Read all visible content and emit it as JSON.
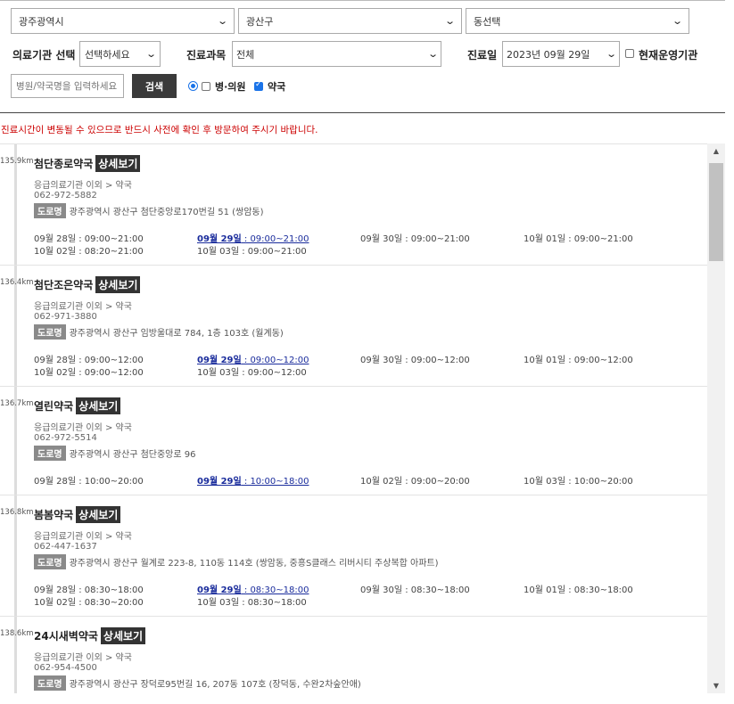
{
  "filters": {
    "region": "광주광역시",
    "district": "광산구",
    "dong": "동선택",
    "institution_label": "의료기관 선택",
    "institution_value": "선택하세요",
    "department_label": "진료과목",
    "department_value": "전체",
    "date_label": "진료일",
    "date_value": "2023년 09월 29일",
    "open_now_label": "현재운영기관",
    "search_placeholder": "병원/약국명을 입력하세요",
    "search_button": "검색",
    "hospital_label": "병·의원",
    "pharmacy_label": "약국"
  },
  "notice": "진료시간이 변동될 수 있으므로 반드시 사전에 확인 후 방문하여 주시기 바랍니다.",
  "colors": {
    "accent": "#1a73e8",
    "notice": "#cc0000",
    "today": "#1a2c9c",
    "detail_bg": "#333333",
    "road_bg": "#8a8a8a"
  },
  "results": [
    {
      "distance": "135.9km",
      "name": "첨단종로약국",
      "detail": "상세보기",
      "category": "응급의료기관 이외 > 약국",
      "phone": "062-972-5882",
      "road": "도로명",
      "address": "광주광역시 광산구 첨단중앙로170번길 51 (쌍암동)",
      "hours": [
        {
          "day": "09월 28일",
          "time": " : 09:00~21:00",
          "today": false
        },
        {
          "day": "09월 29일",
          "time": " : 09:00~21:00",
          "today": true
        },
        {
          "day": "09월 30일",
          "time": " : 09:00~21:00",
          "today": false
        },
        {
          "day": "10월 01일",
          "time": " : 09:00~21:00",
          "today": false
        },
        {
          "day": "10월 02일",
          "time": " : 08:20~21:00",
          "today": false
        },
        {
          "day": "10월 03일",
          "time": " : 09:00~21:00",
          "today": false
        }
      ]
    },
    {
      "distance": "136.4km",
      "name": "첨단조은약국",
      "detail": "상세보기",
      "category": "응급의료기관 이외 > 약국",
      "phone": "062-971-3880",
      "road": "도로명",
      "address": "광주광역시 광산구 임방울대로 784, 1층 103호 (월계동)",
      "hours": [
        {
          "day": "09월 28일",
          "time": " : 09:00~12:00",
          "today": false
        },
        {
          "day": "09월 29일",
          "time": " : 09:00~12:00",
          "today": true
        },
        {
          "day": "09월 30일",
          "time": " : 09:00~12:00",
          "today": false
        },
        {
          "day": "10월 01일",
          "time": " : 09:00~12:00",
          "today": false
        },
        {
          "day": "10월 02일",
          "time": " : 09:00~12:00",
          "today": false
        },
        {
          "day": "10월 03일",
          "time": " : 09:00~12:00",
          "today": false
        }
      ]
    },
    {
      "distance": "136.7km",
      "name": "열린약국",
      "detail": "상세보기",
      "category": "응급의료기관 이외 > 약국",
      "phone": "062-972-5514",
      "road": "도로명",
      "address": "광주광역시 광산구 첨단중앙로 96",
      "hours": [
        {
          "day": "09월 28일",
          "time": " : 10:00~20:00",
          "today": false
        },
        {
          "day": "09월 29일",
          "time": " : 10:00~18:00",
          "today": true
        },
        {
          "day": "10월 02일",
          "time": " : 09:00~20:00",
          "today": false
        },
        {
          "day": "10월 03일",
          "time": " : 10:00~20:00",
          "today": false
        }
      ]
    },
    {
      "distance": "136.8km",
      "name": "봄봄약국",
      "detail": "상세보기",
      "category": "응급의료기관 이외 > 약국",
      "phone": "062-447-1637",
      "road": "도로명",
      "address": "광주광역시 광산구 월계로 223-8, 110동 114호 (쌍암동, 중흥S클래스 리버시티 주상복합 아파트)",
      "hours": [
        {
          "day": "09월 28일",
          "time": " : 08:30~18:00",
          "today": false
        },
        {
          "day": "09월 29일",
          "time": " : 08:30~18:00",
          "today": true
        },
        {
          "day": "09월 30일",
          "time": " : 08:30~18:00",
          "today": false
        },
        {
          "day": "10월 01일",
          "time": " : 08:30~18:00",
          "today": false
        },
        {
          "day": "10월 02일",
          "time": " : 08:30~20:00",
          "today": false
        },
        {
          "day": "10월 03일",
          "time": " : 08:30~18:00",
          "today": false
        }
      ]
    },
    {
      "distance": "138.6km",
      "name": "24시새벽약국",
      "detail": "상세보기",
      "category": "응급의료기관 이외 > 약국",
      "phone": "062-954-4500",
      "road": "도로명",
      "address": "광주광역시 광산구 장덕로95번길 16, 207동 107호 (장덕동, 수완2차숲안애)",
      "hours": []
    }
  ]
}
